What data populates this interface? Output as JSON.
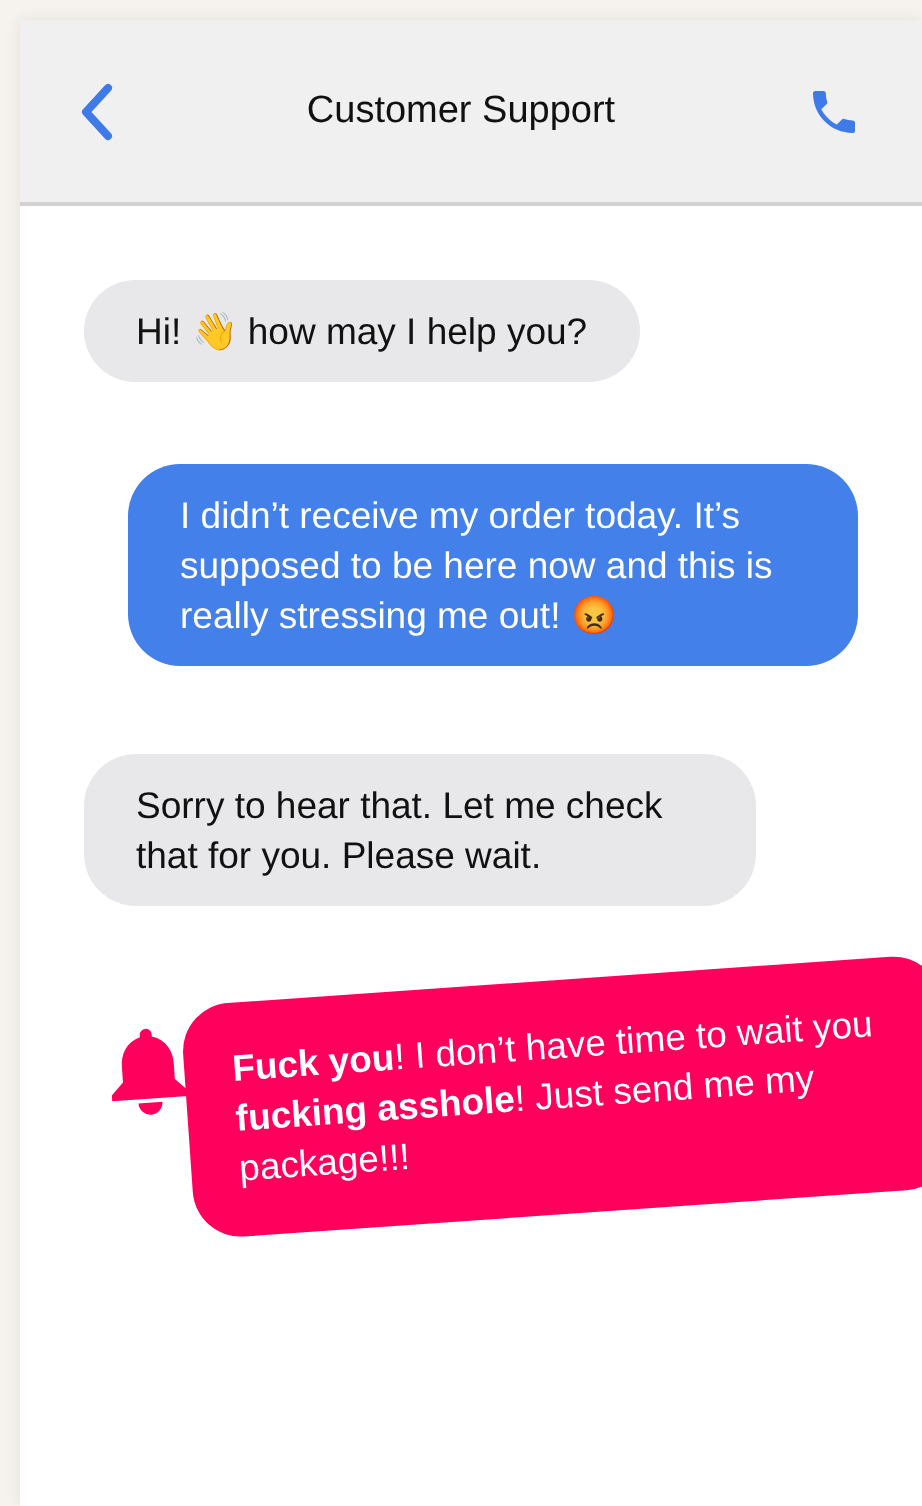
{
  "header": {
    "title": "Customer Support"
  },
  "messages": [
    {
      "kind": "received",
      "text": "Hi! 👋 how may I help you?"
    },
    {
      "kind": "sent",
      "text": "I didn’t receive my order today.  It’s supposed to be here now and this is really stressing me out! 😡"
    },
    {
      "kind": "received",
      "text": "Sorry to hear that. Let me check that for you. Please wait."
    },
    {
      "kind": "flagged",
      "text": "**Fuck you**! I don’t have time to wait you **fucking asshole**! Just send me my package!!!"
    }
  ]
}
